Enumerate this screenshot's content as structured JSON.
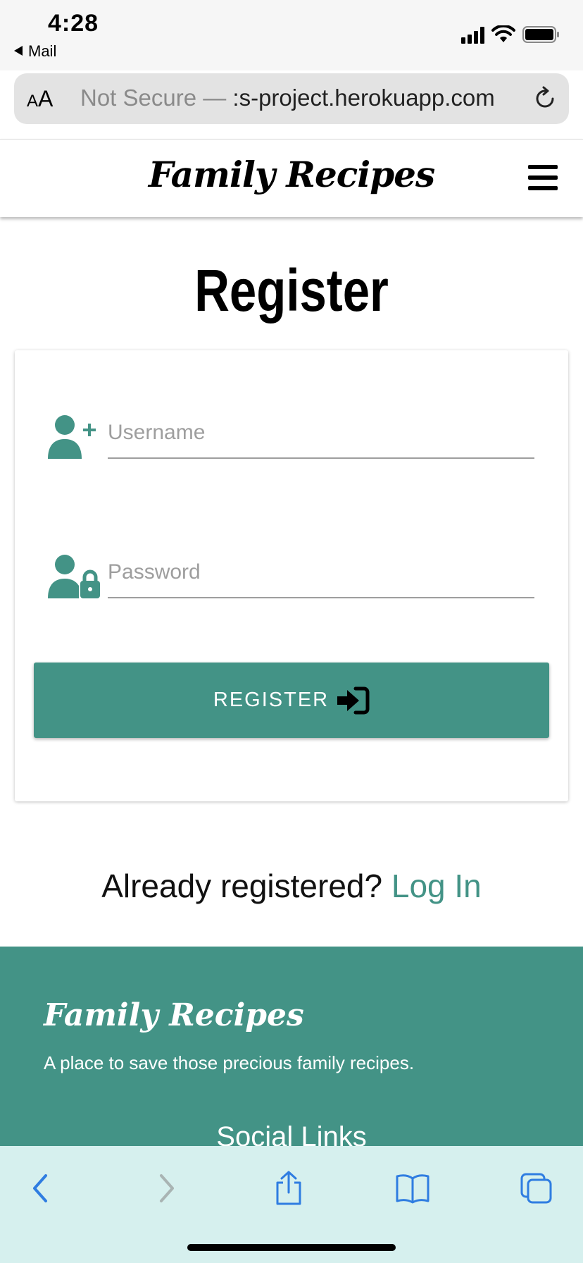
{
  "status_bar": {
    "time": "4:28",
    "back_app": "Mail"
  },
  "address_bar": {
    "text_size_label_small": "A",
    "text_size_label_large": "A",
    "url_prefix": "Not Secure — ",
    "url_fragment": ":s-project.herokuapp.com",
    "reload_icon": "reload-icon"
  },
  "header": {
    "brand": "Family Recipes",
    "menu_icon": "hamburger-icon"
  },
  "page": {
    "title": "Register",
    "form": {
      "username": {
        "placeholder": "Username",
        "value": "",
        "icon": "user-plus-icon"
      },
      "password": {
        "placeholder": "Password",
        "value": "",
        "icon": "user-lock-icon"
      },
      "submit_label": "REGISTER",
      "submit_icon": "sign-in-icon"
    },
    "login_prompt": {
      "text": "Already registered?",
      "link": "Log In"
    }
  },
  "footer": {
    "brand": "Family Recipes",
    "tagline": "A place to save those precious family recipes.",
    "social_heading": "Social Links"
  },
  "toolbar": {
    "icons": [
      "back-icon",
      "forward-icon",
      "share-icon",
      "bookmarks-icon",
      "tabs-icon"
    ]
  },
  "colors": {
    "accent": "#439386",
    "toolbar_bg": "#d6f0ee",
    "toolbar_icon": "#2f7de1"
  }
}
